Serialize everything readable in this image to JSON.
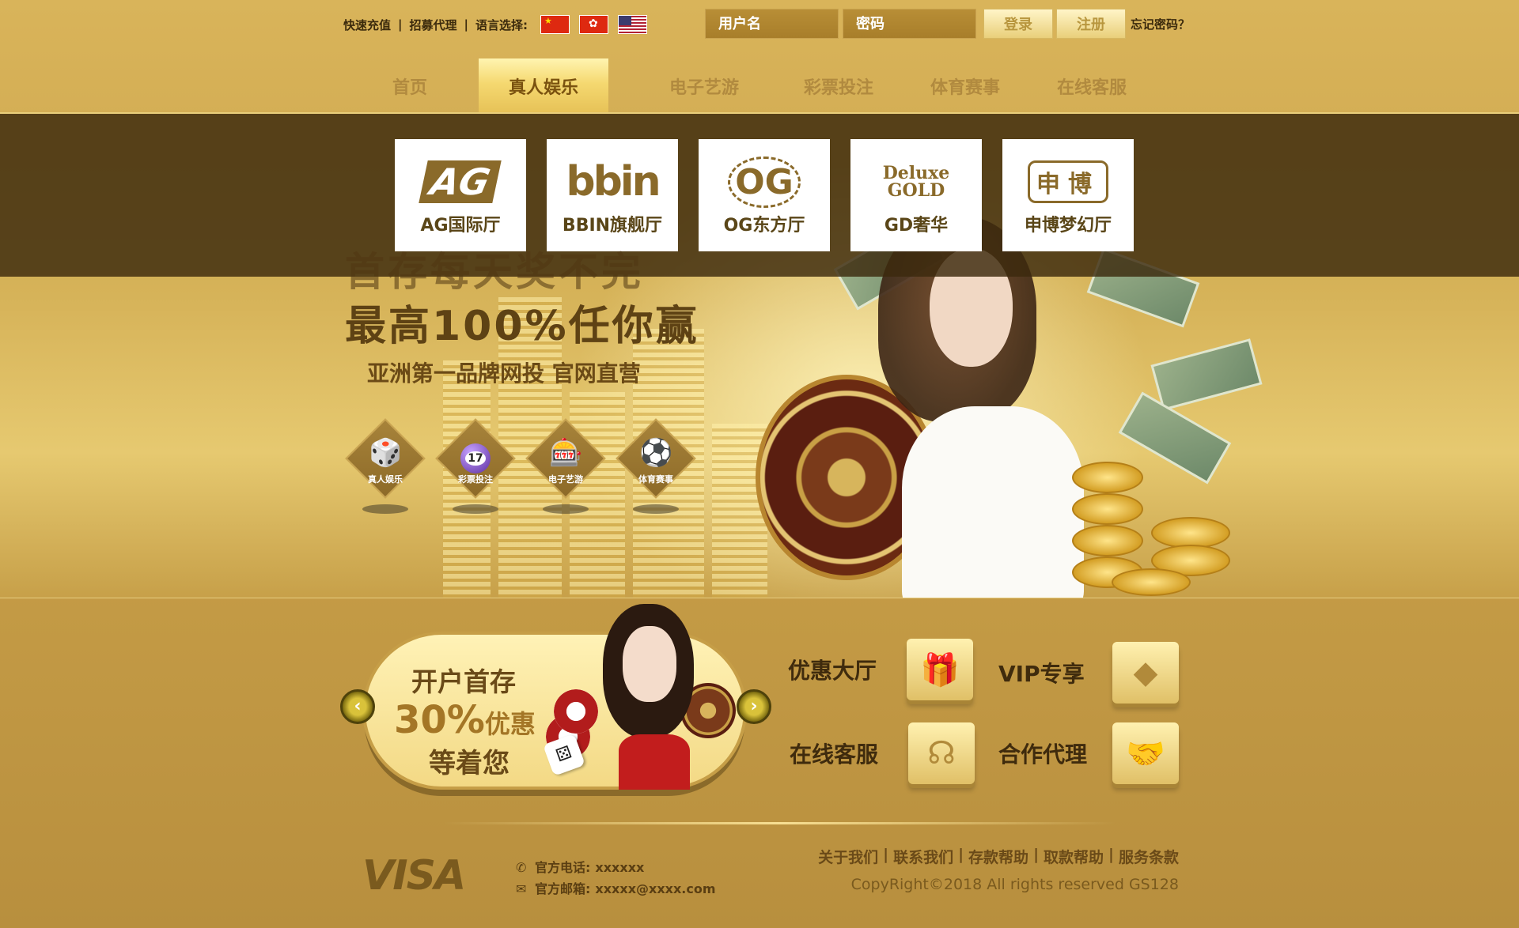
{
  "topbar": {
    "links": [
      "快速充值",
      "招募代理"
    ],
    "language_label": "语言选择:",
    "flags": [
      "cn-flag-icon",
      "hk-flag-icon",
      "us-flag-icon"
    ],
    "username_placeholder": "用户名",
    "password_placeholder": "密码",
    "login_label": "登录",
    "register_label": "注册",
    "forgot_label": "忘记密码？"
  },
  "nav": {
    "items": [
      {
        "label": "首页"
      },
      {
        "label": "真人娱乐",
        "active": true
      },
      {
        "label": "电子艺游"
      },
      {
        "label": "彩票投注"
      },
      {
        "label": "体育赛事"
      },
      {
        "label": "在线客服"
      }
    ]
  },
  "hero": {
    "tiles": [
      {
        "logo": "AG",
        "label": "AG国际厅"
      },
      {
        "logo": "bbin",
        "label": "BBIN旗舰厅"
      },
      {
        "logo": "OG",
        "label": "OG东方厅"
      },
      {
        "logo": "Deluxe GOLD",
        "label": "GD奢华"
      },
      {
        "logo": "申博",
        "label": "申博梦幻厅"
      }
    ],
    "slogan_line1": "首存每天奖不完",
    "slogan_line2": "最高100%任你赢",
    "slogan_line3": "亚洲第一品牌网投 官网直营",
    "categories": [
      {
        "label": "真人娱乐",
        "icon": "dice-icon"
      },
      {
        "label": "彩票投注",
        "icon": "lottery-ball-icon"
      },
      {
        "label": "电子艺游",
        "icon": "slot-machine-icon"
      },
      {
        "label": "体育赛事",
        "icon": "soccer-ball-icon"
      }
    ],
    "lottery_number": "17"
  },
  "promo": {
    "banner_line1": "开户首存",
    "banner_percent": "30%",
    "banner_suffix": "优惠",
    "banner_line3": "等着您",
    "features": [
      {
        "label": "优惠大厅",
        "icon": "gift-icon"
      },
      {
        "label": "VIP专享",
        "icon": "diamond-icon"
      },
      {
        "label": "在线客服",
        "icon": "headset-icon"
      },
      {
        "label": "合作代理",
        "icon": "handshake-icon"
      }
    ]
  },
  "footer": {
    "card_brand": "VISA",
    "phone_label": "官方电话:",
    "phone_value": "xxxxxx",
    "email_label": "官方邮箱:",
    "email_value": "xxxxx@xxxx.com",
    "links": [
      "关于我们",
      "联系我们",
      "存款帮助",
      "取款帮助",
      "服务条款"
    ],
    "copyright": "CopyRight©2018 All rights reserved GS128"
  },
  "colors": {
    "gold_bg": "#caa24a",
    "nav_active": "#f5d870",
    "nav_text": "#b18a3f",
    "dark_band": "#3c2a0e",
    "text_dark": "#3b2a0c"
  }
}
